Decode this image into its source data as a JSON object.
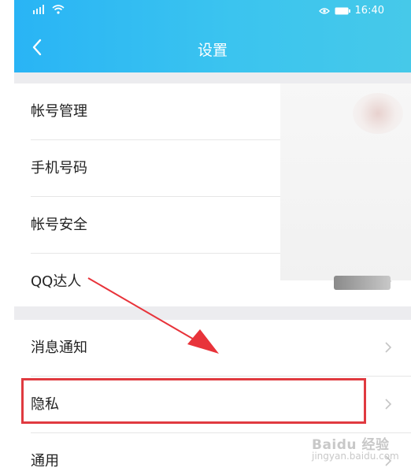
{
  "status_bar": {
    "time": "16:40",
    "icons": [
      "signal-icon",
      "wifi-icon",
      "eye-icon",
      "battery-icon"
    ]
  },
  "header": {
    "title": "设置",
    "back_icon": "chevron-left-icon"
  },
  "settings": {
    "group1": [
      {
        "label": "帐号管理"
      },
      {
        "label": "手机号码"
      },
      {
        "label": "帐号安全"
      },
      {
        "label": "QQ达人"
      }
    ],
    "group2": [
      {
        "label": "消息通知"
      },
      {
        "label": "隐私"
      },
      {
        "label": "通用"
      }
    ]
  },
  "watermark": {
    "brand": "Baidu 经验",
    "url": "jingyan.baidu.com"
  },
  "colors": {
    "header_start": "#29b4f5",
    "header_end": "#46c9e9",
    "highlight": "#e03a40",
    "arrow": "#e8333a"
  }
}
